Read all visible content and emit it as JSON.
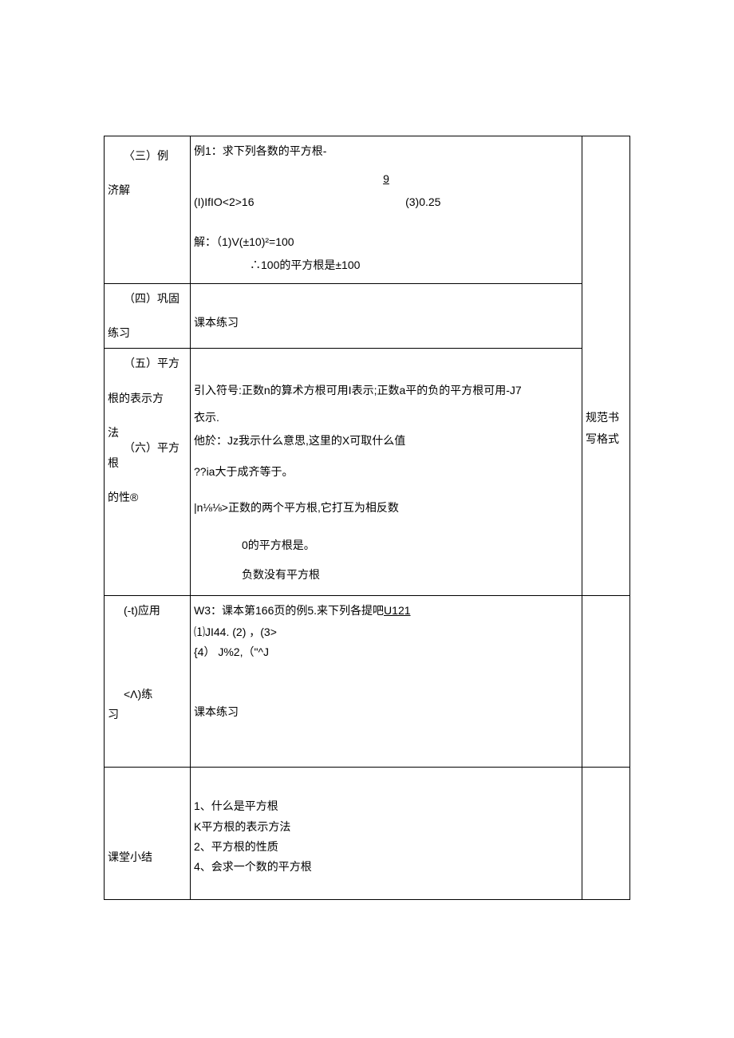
{
  "row1": {
    "left": {
      "p1": "〈三）例",
      "p2": "济解"
    },
    "mid": {
      "line1": "例1：求下列各数的平方根-",
      "nine": "9",
      "line2a": "(I)IfIO<2>16",
      "line2b": "(3)0.25",
      "line3": "解：（1)V(±10)²=100",
      "line4": "∴100的平方根是±100"
    }
  },
  "row2": {
    "left": {
      "p1": "（四）巩固",
      "p2": "练习"
    },
    "mid": "课本练习"
  },
  "row3": {
    "left": {
      "p1": "（五）平方",
      "p2": "根的表示方",
      "p3": "法",
      "p4": "（六）平方",
      "p4b": "根",
      "p5": "的性®"
    },
    "mid": {
      "l1": "引入符号:正数n的算术方根可用I表示;正数a平的负的平方根可用-J7",
      "l2": "衣示.",
      "l3": "他於：Jz我示什么意思,这里的X可取什么值",
      "l4": "??ia大于成齐等于。",
      "l5": "|n⅛⅛>正数的两个平方根,它打互为相反数",
      "l6": "0的平方根是。",
      "l7": "负数没有平方根"
    },
    "right": {
      "l1": "规范书",
      "l2": "写格式"
    }
  },
  "row4": {
    "left": {
      "p1": "(-t)应用",
      "p2": "<Λ)练",
      "p3": "习"
    },
    "mid": {
      "l1a": "W3：课本第166页的例5.来下列各提吧",
      "l1b": "U121",
      "l2": "⑴JI44. (2) ，(3>",
      "l3": "{4） J%2,（\"^J",
      "l4": "课本练习"
    }
  },
  "row5": {
    "left": "课堂小结",
    "mid": {
      "l1": "1、什么是平方根",
      "l2": "K平方根的表示方法",
      "l3": "2、平方根的性质",
      "l4": "4、会求一个数的平方根"
    }
  }
}
